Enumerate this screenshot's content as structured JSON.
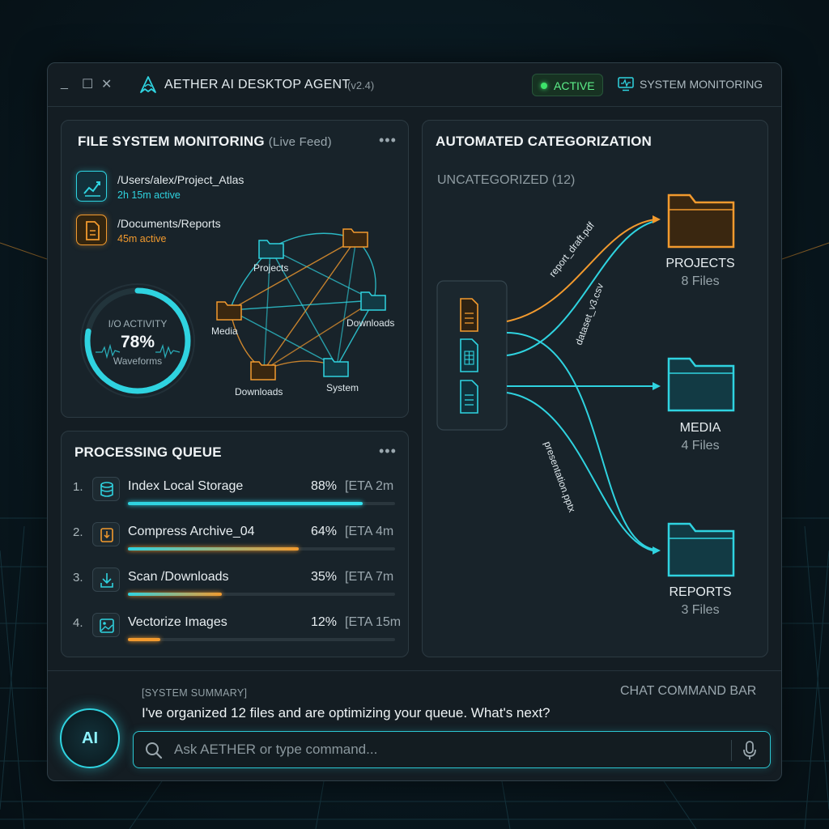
{
  "window": {
    "controls": {
      "minimize": "_",
      "maximize": "☐",
      "close": "✕"
    },
    "title": "AETHER AI DESKTOP AGENT",
    "version": "(v2.4)",
    "status": "ACTIVE",
    "monitoring_label": "SYSTEM MONITORING"
  },
  "fs_monitor": {
    "title": "FILE SYSTEM MONITORING",
    "subtitle": "(Live Feed)",
    "menu": "•••",
    "paths": [
      {
        "path": "/Users/alex/Project_Atlas",
        "duration": "2h 15m active",
        "icon": "chart-icon",
        "color": "#2fd3e0"
      },
      {
        "path": "/Documents/Reports",
        "duration": "45m active",
        "icon": "document-icon",
        "color": "#f29a2e"
      }
    ],
    "gauge": {
      "label": "I/O ACTIVITY",
      "value_text": "78%",
      "value": 78,
      "sub": "Waveforms"
    },
    "network": {
      "nodes": [
        "Projects",
        "Media",
        "Downloads",
        "Downloads",
        "System"
      ]
    }
  },
  "queue": {
    "title": "PROCESSING QUEUE",
    "menu": "•••",
    "items": [
      {
        "num": "1.",
        "name": "Index Local Storage",
        "pct": "88%",
        "eta": "[ETA 2m",
        "progress": 0.88,
        "icon": "database-icon",
        "color": "#2fd3e0"
      },
      {
        "num": "2.",
        "name": "Compress Archive_04",
        "pct": "64%",
        "eta": "[ETA 4m",
        "progress": 0.64,
        "icon": "archive-icon",
        "color": "#f29a2e"
      },
      {
        "num": "3.",
        "name": "Scan /Downloads",
        "pct": "35%",
        "eta": "[ETA 7m",
        "progress": 0.35,
        "icon": "download-icon",
        "color": "#f29a2e"
      },
      {
        "num": "4.",
        "name": "Vectorize Images",
        "pct": "12%",
        "eta": "[ETA 15m",
        "progress": 0.12,
        "icon": "image-icon",
        "color": "#f29a2e"
      }
    ]
  },
  "categorization": {
    "title": "AUTOMATED CATEGORIZATION",
    "uncategorized": "UNCATEGORIZED (12)",
    "flow_labels": [
      "report_draft.pdf",
      "dataset_v3.csv",
      "presentation.pptx"
    ],
    "categories": [
      {
        "name": "PROJECTS",
        "count": "8 Files",
        "color": "#f29a2e"
      },
      {
        "name": "MEDIA",
        "count": "4 Files",
        "color": "#2fd3e0"
      },
      {
        "name": "REPORTS",
        "count": "3 Files",
        "color": "#2fd3e0"
      }
    ]
  },
  "chat": {
    "avatar_text": "AI",
    "summary_label": "[SYSTEM SUMMARY]",
    "summary_message": "I've organized 12 files and are optimizing your queue. What's next?",
    "command_bar_label": "CHAT COMMAND BAR",
    "input_placeholder": "Ask AETHER or type command...",
    "input_value": ""
  },
  "colors": {
    "accent_cyan": "#2fd3e0",
    "accent_orange": "#f29a2e",
    "active_green": "#3de36a"
  }
}
